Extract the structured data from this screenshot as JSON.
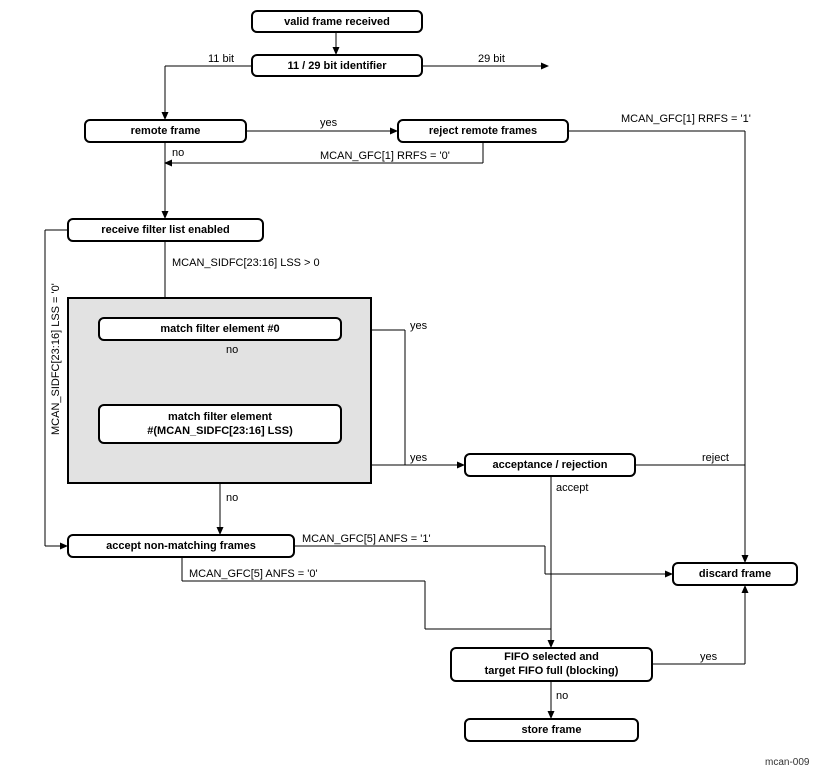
{
  "boxes": {
    "valid_frame": "valid frame received",
    "identifier": "11 / 29 bit identifier",
    "remote_frame": "remote frame",
    "reject_remote": "reject remote frames",
    "filter_list": "receive filter list enabled",
    "match0": "match filter element #0",
    "matchN_l1": "match filter element",
    "matchN_l2": "#(MCAN_SIDFC[23:16] LSS)",
    "accept_reject": "acceptance / rejection",
    "accept_nonmatch": "accept non-matching frames",
    "discard": "discard frame",
    "fifo_l1": "FIFO selected and",
    "fifo_l2": "target FIFO full (blocking)",
    "store": "store frame"
  },
  "labels": {
    "bit11": "11 bit",
    "bit29": "29 bit",
    "yes": "yes",
    "no": "no",
    "rrfs1": "MCAN_GFC[1] RRFS = '1'",
    "rrfs0": "MCAN_GFC[1] RRFS = '0'",
    "lss_gt0": "MCAN_SIDFC[23:16] LSS > 0",
    "lss_eq0": "MCAN_SIDFC[23:16] LSS = '0'",
    "anfs1": "MCAN_GFC[5] ANFS = '1'",
    "anfs0": "MCAN_GFC[5] ANFS = '0'",
    "reject": "reject",
    "accept": "accept",
    "figid": "mcan-009"
  }
}
